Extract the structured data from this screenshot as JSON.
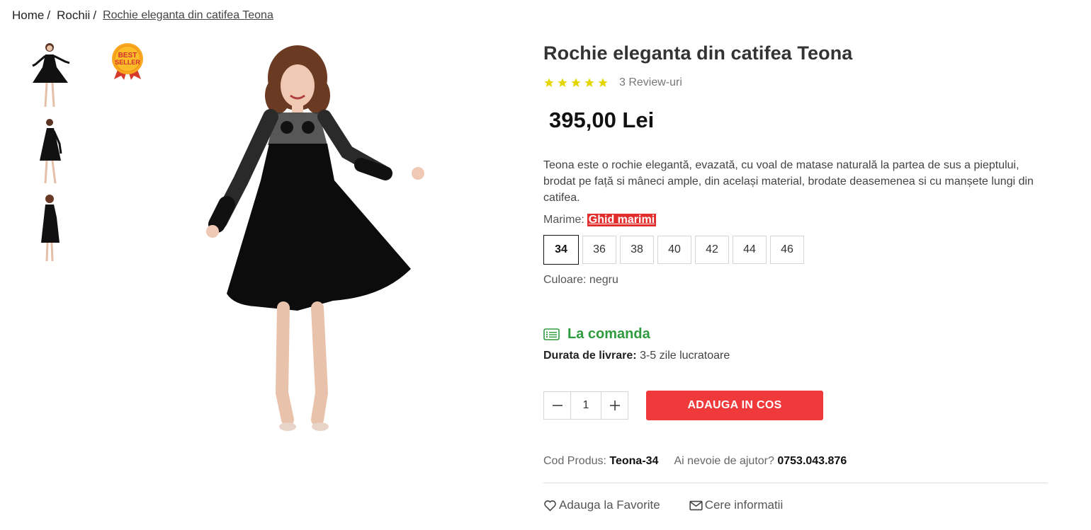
{
  "breadcrumb": {
    "home": "Home",
    "category": "Rochii",
    "current": "Rochie eleganta din catifea Teona",
    "separator": "/"
  },
  "badge": {
    "line1": "BEST",
    "line2": "SELLER"
  },
  "product": {
    "title": "Rochie eleganta din catifea Teona",
    "rating": 5,
    "reviews_label": "3 Review-uri",
    "price": "395,00 Lei",
    "description": "Teona este o rochie elegantă, evazată, cu voal de matase naturală la partea de sus a pieptului, brodat pe față si mâneci ample, din același material, brodate deasemenea si cu manșete lungi din catifea.",
    "size_label": "Marime:",
    "size_guide": "Ghid marimi",
    "sizes": [
      "34",
      "36",
      "38",
      "40",
      "42",
      "44",
      "46"
    ],
    "selected_size": "34",
    "color_label": "Culoare: negru",
    "stock_status": "La comanda",
    "delivery_label": "Durata de livrare:",
    "delivery_value": "3-5  zile lucratoare",
    "quantity": "1",
    "add_to_cart": "ADAUGA IN COS",
    "code_label": "Cod Produs:",
    "code_value": "Teona-34",
    "help_label": "Ai nevoie de ajutor?",
    "help_phone": "0753.043.876",
    "favorite": "Adauga la Favorite",
    "info": "Cere informatii"
  },
  "colors": {
    "accent": "#f0393a",
    "stock": "#2e9b3e",
    "star": "#e4d600"
  },
  "icons": {
    "minus": "minus-icon",
    "plus": "plus-icon",
    "heart": "heart-icon",
    "mail": "envelope-icon",
    "stock": "list-icon"
  }
}
